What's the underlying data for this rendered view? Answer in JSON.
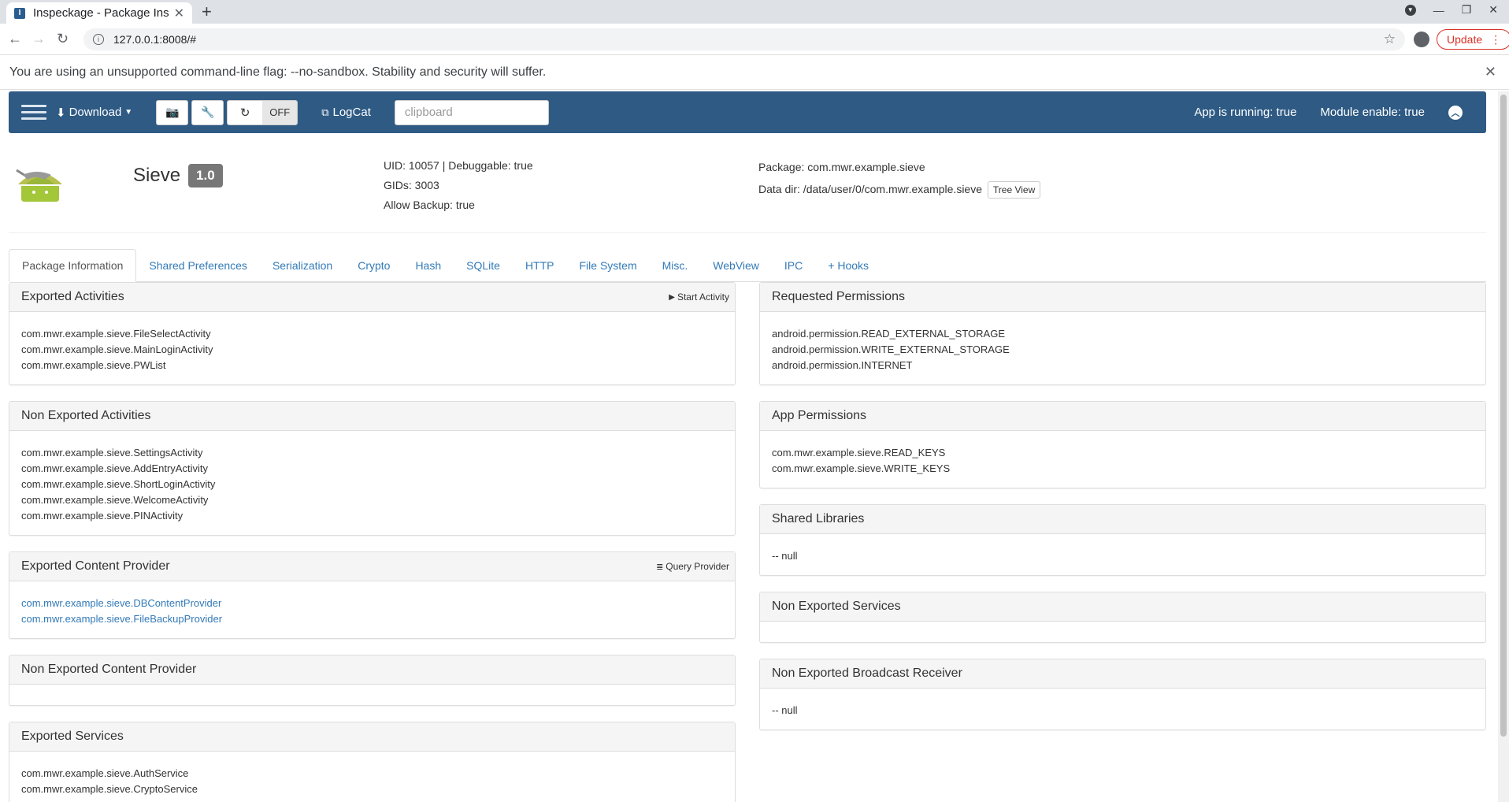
{
  "browser": {
    "tab_title": "Inspeckage - Package Insp",
    "url": "127.0.0.1:8008/#",
    "update_label": "Update",
    "infobar_text": "You are using an unsupported command-line flag: --no-sandbox. Stability and security will suffer."
  },
  "navbar": {
    "download_label": "Download",
    "toggle_state": "OFF",
    "logcat_label": "LogCat",
    "clipboard_placeholder": "clipboard",
    "app_running": "App is running: true",
    "module_enable": "Module enable: true"
  },
  "header": {
    "app_name": "Sieve",
    "version": "1.0",
    "uid_line": "UID: 10057 | Debuggable: true",
    "gids": "GIDs: 3003",
    "allow_backup": "Allow Backup: true",
    "package": "Package: com.mwr.example.sieve",
    "data_dir": "Data dir: /data/user/0/com.mwr.example.sieve",
    "tree_view_label": "Tree View"
  },
  "tabs": [
    {
      "label": "Package Information"
    },
    {
      "label": "Shared Preferences"
    },
    {
      "label": "Serialization"
    },
    {
      "label": "Crypto"
    },
    {
      "label": "Hash"
    },
    {
      "label": "SQLite"
    },
    {
      "label": "HTTP"
    },
    {
      "label": "File System"
    },
    {
      "label": "Misc."
    },
    {
      "label": "WebView"
    },
    {
      "label": "IPC"
    },
    {
      "label": "+ Hooks"
    }
  ],
  "left_panels": {
    "exported_activities": {
      "title": "Exported Activities",
      "button": "Start Activity",
      "items": [
        "com.mwr.example.sieve.FileSelectActivity",
        "com.mwr.example.sieve.MainLoginActivity",
        "com.mwr.example.sieve.PWList"
      ]
    },
    "non_exported_activities": {
      "title": "Non Exported Activities",
      "items": [
        "com.mwr.example.sieve.SettingsActivity",
        "com.mwr.example.sieve.AddEntryActivity",
        "com.mwr.example.sieve.ShortLoginActivity",
        "com.mwr.example.sieve.WelcomeActivity",
        "com.mwr.example.sieve.PINActivity"
      ]
    },
    "exported_content_provider": {
      "title": "Exported Content Provider",
      "button": "Query Provider",
      "items": [
        "com.mwr.example.sieve.DBContentProvider",
        "com.mwr.example.sieve.FileBackupProvider"
      ]
    },
    "non_exported_content_provider": {
      "title": "Non Exported Content Provider"
    },
    "exported_services": {
      "title": "Exported Services",
      "items": [
        "com.mwr.example.sieve.AuthService",
        "com.mwr.example.sieve.CryptoService"
      ]
    }
  },
  "right_panels": {
    "requested_permissions": {
      "title": "Requested Permissions",
      "items": [
        "android.permission.READ_EXTERNAL_STORAGE",
        "android.permission.WRITE_EXTERNAL_STORAGE",
        "android.permission.INTERNET"
      ]
    },
    "app_permissions": {
      "title": "App Permissions",
      "items": [
        "com.mwr.example.sieve.READ_KEYS",
        "com.mwr.example.sieve.WRITE_KEYS"
      ]
    },
    "shared_libraries": {
      "title": "Shared Libraries",
      "items": [
        "-- null"
      ]
    },
    "non_exported_services": {
      "title": "Non Exported Services"
    },
    "non_exported_broadcast_receiver": {
      "title": "Non Exported Broadcast Receiver",
      "items": [
        "-- null"
      ]
    }
  },
  "colors": {
    "navbar_bg": "#2e5a84",
    "link": "#337ab7",
    "update_red": "#d93025"
  }
}
